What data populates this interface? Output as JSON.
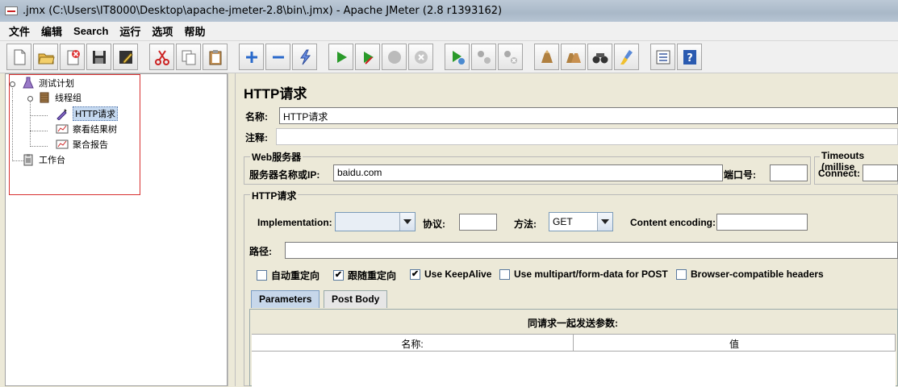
{
  "window": {
    "title": ".jmx (C:\\Users\\IT8000\\Desktop\\apache-jmeter-2.8\\bin\\.jmx) - Apache JMeter (2.8 r1393162)"
  },
  "menu": [
    "文件",
    "编辑",
    "Search",
    "运行",
    "选项",
    "帮助"
  ],
  "toolbar": {
    "icons": [
      "new-icon",
      "open-icon",
      "close-icon",
      "save-icon",
      "save-as-icon",
      "cut-icon",
      "copy-icon",
      "paste-icon",
      "expand-icon",
      "collapse-icon",
      "toggle-icon",
      "start-icon",
      "start-no-pause-icon",
      "stop-icon",
      "shutdown-icon",
      "remote-start-icon",
      "remote-stop-icon",
      "remote-shutdown-icon",
      "clear-icon",
      "clear-all-icon",
      "search-icon",
      "reset-search-icon",
      "function-helper-icon",
      "help-icon"
    ]
  },
  "tree": {
    "items": [
      {
        "label": "测试计划",
        "icon": "flask-icon"
      },
      {
        "label": "线程组",
        "icon": "spool-icon"
      },
      {
        "label": "HTTP请求",
        "icon": "pipette-icon"
      },
      {
        "label": "察看结果树",
        "icon": "chart-icon"
      },
      {
        "label": "聚合报告",
        "icon": "chart-icon"
      },
      {
        "label": "工作台",
        "icon": "clipboard-icon"
      }
    ]
  },
  "sampler": {
    "title": "HTTP请求",
    "name_label": "名称:",
    "name_value": "HTTP请求",
    "comment_label": "注释:",
    "comment_value": ""
  },
  "web_server": {
    "group_title": "Web服务器",
    "server_label": "服务器名称或IP:",
    "server_value": "baidu.com",
    "port_label": "端口号:",
    "port_value": ""
  },
  "timeouts": {
    "group_title": "Timeouts (millise",
    "connect_label": "Connect:",
    "connect_value": ""
  },
  "http_request": {
    "group_title": "HTTP请求",
    "implementation_label": "Implementation:",
    "implementation_value": "",
    "protocol_label": "协议:",
    "protocol_value": "",
    "method_label": "方法:",
    "method_value": "GET",
    "encoding_label": "Content encoding:",
    "encoding_value": "",
    "path_label": "路径:",
    "path_value": ""
  },
  "options": [
    {
      "label": "自动重定向",
      "checked": false
    },
    {
      "label": "跟随重定向",
      "checked": true
    },
    {
      "label": "Use KeepAlive",
      "checked": true
    },
    {
      "label": "Use multipart/form-data for POST",
      "checked": false
    },
    {
      "label": "Browser-compatible headers",
      "checked": false
    }
  ],
  "tabs": [
    {
      "label": "Parameters",
      "active": true
    },
    {
      "label": "Post Body",
      "active": false
    }
  ],
  "params_table": {
    "caption": "同请求一起发送参数:",
    "columns": [
      "名称:",
      "值"
    ]
  },
  "colors": {
    "selection": "#c5d9f0",
    "highlight_box": "#d83030",
    "active_tab": "#c7d7ea"
  }
}
